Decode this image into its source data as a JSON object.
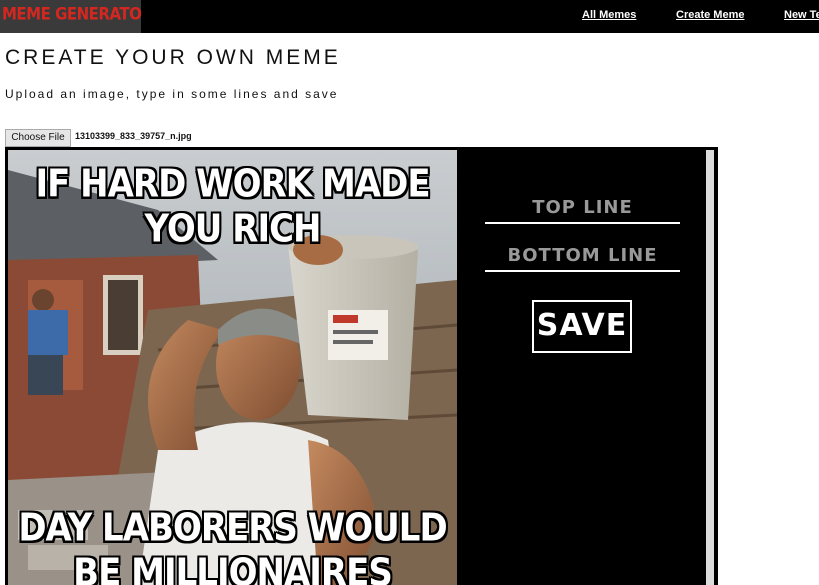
{
  "nav": {
    "logo": "MEME GENERATOR",
    "links": [
      "All Memes",
      "Create Meme",
      "New Te"
    ]
  },
  "header": {
    "title": "CREATE YOUR OWN MEME",
    "subtitle": "Upload an image, type in some lines and save"
  },
  "upload": {
    "button_label": "Choose File",
    "file_name": "13103399_833_39757_n.jpg"
  },
  "meme": {
    "top_text": "IF HARD WORK MADE YOU RICH",
    "bottom_text": "DAY LABORERS WOULD BE MILLIONAIRES"
  },
  "controls": {
    "top_line_placeholder": "TOP LINE",
    "bottom_line_placeholder": "BOTTOM LINE",
    "save_label": "SAVE"
  },
  "colors": {
    "nav_bg": "#000000",
    "logo_bg": "#3a3a3a",
    "logo_text": "#d4271f",
    "editor_bg": "#000000",
    "placeholder": "#999999"
  }
}
